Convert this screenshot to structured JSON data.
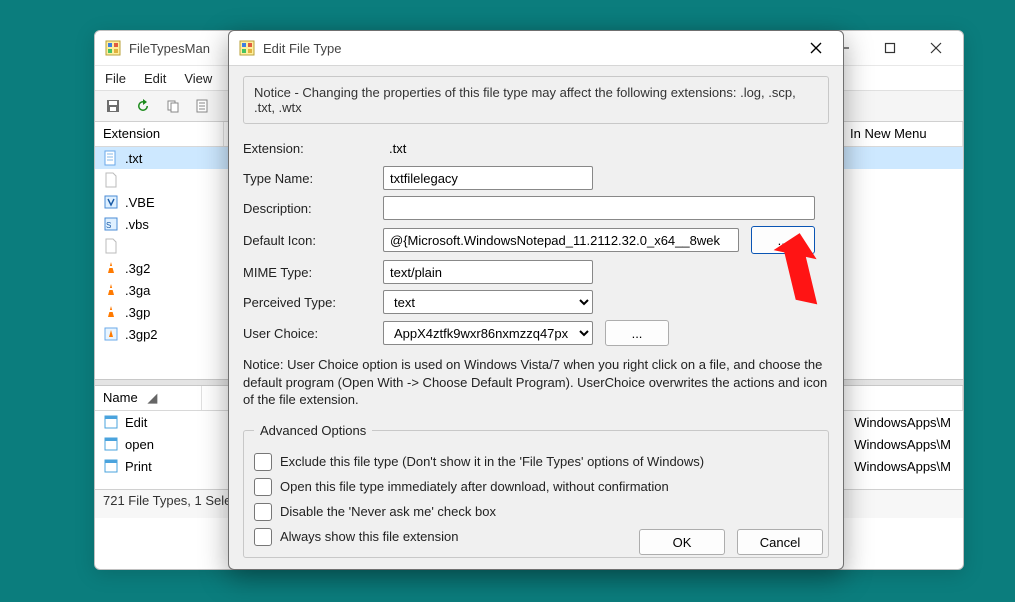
{
  "main": {
    "title": "FileTypesMan",
    "menus": [
      "File",
      "Edit",
      "View"
    ],
    "columns": {
      "ext": "Extension",
      "innew": "In New Menu"
    },
    "rows": [
      {
        "ext": ".txt",
        "icon": "txt",
        "sel": true
      },
      {
        "ext": "",
        "icon": "blank"
      },
      {
        "ext": ".VBE",
        "icon": "vbe"
      },
      {
        "ext": ".vbs",
        "icon": "vbs"
      },
      {
        "ext": "",
        "icon": "blank2"
      },
      {
        "ext": ".3g2",
        "icon": "vlc"
      },
      {
        "ext": ".3ga",
        "icon": "vlc"
      },
      {
        "ext": ".3gp",
        "icon": "vlc"
      },
      {
        "ext": ".3gp2",
        "icon": "vlc2"
      }
    ],
    "bottom": {
      "colName": "Name",
      "rows": [
        "Edit",
        "open",
        "Print"
      ],
      "rightCol": "WindowsApps\\M"
    },
    "status": "721 File Types, 1 Sele"
  },
  "dialog": {
    "title": "Edit File Type",
    "notice": "Notice - Changing the properties of this file type may affect the following extensions: .log, .scp, .txt, .wtx",
    "labels": {
      "ext": "Extension:",
      "type": "Type Name:",
      "desc": "Description:",
      "icon": "Default Icon:",
      "mime": "MIME Type:",
      "perc": "Perceived Type:",
      "userc": "User Choice:"
    },
    "values": {
      "ext": ".txt",
      "type": "txtfilelegacy",
      "desc": "",
      "icon": "@{Microsoft.WindowsNotepad_11.2112.32.0_x64__8wek",
      "mime": "text/plain",
      "perc": "text",
      "userc": "AppX4ztfk9wxr86nxmzzq47px"
    },
    "browse": "...",
    "usercBrowse": "...",
    "noticeUC": "Notice: User Choice option is used on Windows Vista/7 when you right click on a file, and choose the default program (Open With -> Choose Default Program). UserChoice overwrites the actions and icon of the file extension.",
    "adv": {
      "legend": "Advanced Options",
      "opts": [
        "Exclude  this file type (Don't show it in the 'File Types' options of Windows)",
        "Open this file type immediately after download, without confirmation",
        "Disable the 'Never ask me' check box",
        "Always show this file extension"
      ]
    },
    "ok": "OK",
    "cancel": "Cancel"
  }
}
